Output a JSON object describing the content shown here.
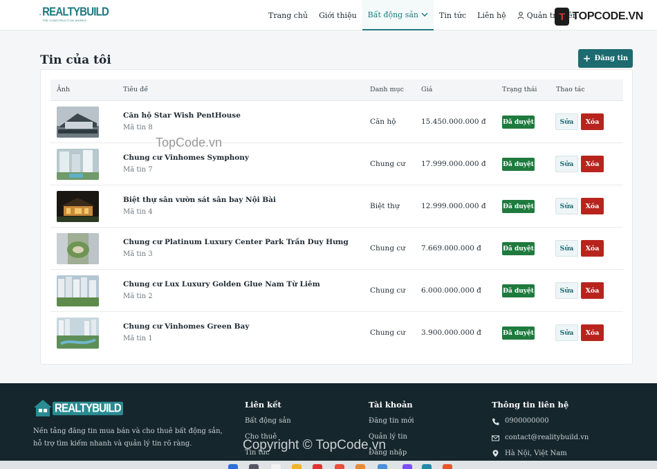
{
  "navbar": {
    "brand": "REALTYBUILD",
    "brand_tagline": "THE CONSTRUCTION WORKS",
    "links": [
      {
        "label": "Trang chủ",
        "active": false
      },
      {
        "label": "Giới thiệu",
        "active": false
      },
      {
        "label": "Bất động sản",
        "active": true
      },
      {
        "label": "Tin tức",
        "active": false
      },
      {
        "label": "Liên hệ",
        "active": false
      },
      {
        "label": "Quản trị viên",
        "active": false
      }
    ],
    "watermark": "TOPCODE.VN"
  },
  "page": {
    "title": "Tin của tôi",
    "new_button": "Đăng tin"
  },
  "table": {
    "headers": [
      "Ảnh",
      "Tiêu đề",
      "Danh mục",
      "Giá",
      "Trạng thái",
      "Thao tác"
    ],
    "rows": [
      {
        "title": "Căn hộ Star Wish PentHouse",
        "code": "Mã tin 8",
        "category": "Căn hộ",
        "price": "15.450.000.000 đ",
        "status": "Đã duyệt",
        "edit": "Sửa",
        "delete": "Xóa"
      },
      {
        "title": "Chung cư Vinhomes Symphony",
        "code": "Mã tin 7",
        "category": "Chung cư",
        "price": "17.999.000.000 đ",
        "status": "Đã duyệt",
        "edit": "Sửa",
        "delete": "Xóa"
      },
      {
        "title": "Biệt thự sân vườn sát sân bay Nội Bài",
        "code": "Mã tin 4",
        "category": "Biệt thự",
        "price": "12.999.000.000 đ",
        "status": "Đã duyệt",
        "edit": "Sửa",
        "delete": "Xóa"
      },
      {
        "title": "Chung cư Platinum Luxury Center Park Trần Duy Hưng",
        "code": "Mã tin 3",
        "category": "Chung cư",
        "price": "7.669.000.000 đ",
        "status": "Đã duyệt",
        "edit": "Sửa",
        "delete": "Xóa"
      },
      {
        "title": "Chung cư Lux Luxury Golden Glue Nam Từ Liêm",
        "code": "Mã tin 2",
        "category": "Chung cư",
        "price": "6.000.000.000 đ",
        "status": "Đã duyệt",
        "edit": "Sửa",
        "delete": "Xóa"
      },
      {
        "title": "Chung cư Vinhomes Green Bay",
        "code": "Mã tin 1",
        "category": "Chung cư",
        "price": "3.900.000.000 đ",
        "status": "Đã duyệt",
        "edit": "Sửa",
        "delete": "Xóa"
      }
    ]
  },
  "watermark_mid": "TopCode.vn",
  "footer": {
    "brand": "REALTYBUILD",
    "desc_line1": "Nền tảng đăng tin mua bán và cho thuê bất động sản,",
    "desc_line2": "hỗ trợ tìm kiếm nhanh và quản lý tin rõ ràng.",
    "links_title": "Liên kết",
    "links": [
      "Bất động sản",
      "Cho thuê",
      "Tin tức"
    ],
    "account_title": "Tài khoản",
    "account": [
      "Đăng tin mới",
      "Quản lý tin",
      "Đăng nhập"
    ],
    "contact_title": "Thông tin liên hệ",
    "contact": {
      "phone": "0900000000",
      "email": "contact@realitybuild.vn",
      "address": "Hà Nội, Việt Nam"
    },
    "copyright": "Copyright © TopCode.vn"
  },
  "colors": {
    "accent": "#1d6a70",
    "status_green": "#1f7a3e",
    "danger": "#b8241d",
    "footer_bg": "#16262d"
  }
}
